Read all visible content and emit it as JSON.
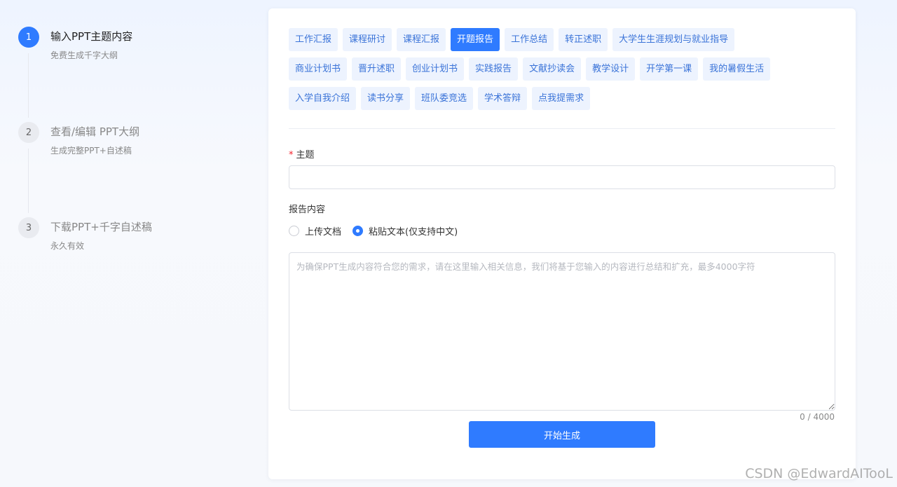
{
  "steps": [
    {
      "num": "1",
      "title": "输入PPT主题内容",
      "sub": "免费生成千字大纲"
    },
    {
      "num": "2",
      "title": "查看/编辑 PPT大纲",
      "sub": "生成完整PPT+自述稿"
    },
    {
      "num": "3",
      "title": "下载PPT+千字自述稿",
      "sub": "永久有效"
    }
  ],
  "tags": [
    "工作汇报",
    "课程研讨",
    "课程汇报",
    "开题报告",
    "工作总结",
    "转正述职",
    "大学生生涯规划与就业指导",
    "商业计划书",
    "晋升述职",
    "创业计划书",
    "实践报告",
    "文献抄读会",
    "教学设计",
    "开学第一课",
    "我的暑假生活",
    "入学自我介绍",
    "读书分享",
    "班队委竞选",
    "学术答辩",
    "点我提需求"
  ],
  "selected_tag": "开题报告",
  "form": {
    "topic_label": "主题",
    "topic_required_mark": "*",
    "topic_value": "",
    "content_label": "报告内容",
    "radio_upload": "上传文档",
    "radio_paste": "粘贴文本(仅支持中文)",
    "selected_radio": "paste",
    "content_placeholder": "为确保PPT生成内容符合您的需求，请在这里输入相关信息，我们将基于您输入的内容进行总结和扩充，最多4000字符",
    "content_value": "",
    "counter": "0 / 4000",
    "submit_label": "开始生成"
  },
  "watermark": "CSDN @EdwardAITooL",
  "colors": {
    "accent": "#2f7bff",
    "tag_bg": "#edf3fe",
    "tag_text": "#3a73d8"
  }
}
